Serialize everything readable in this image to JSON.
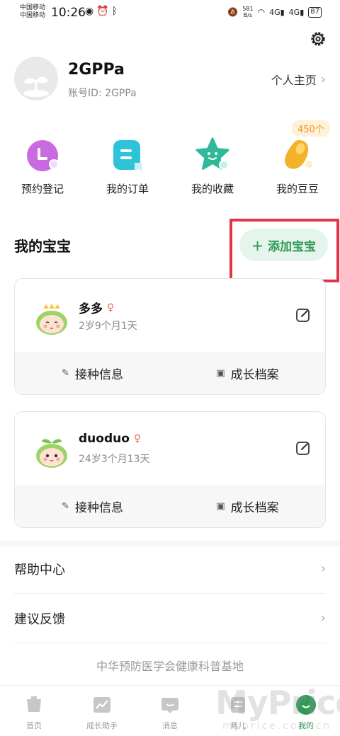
{
  "status_bar": {
    "carrier_1": "中国移动",
    "carrier_2": "中国移动",
    "time": "10:26",
    "net_speed_value": "581",
    "net_speed_unit": "B/s",
    "signal_1": "4G",
    "signal_2": "4G",
    "battery": "87"
  },
  "profile": {
    "username": "2GPPa",
    "account_id": "账号ID: 2GPPa",
    "homepage_label": "个人主页"
  },
  "quick_actions": [
    {
      "label": "预约登记",
      "icon": "appointment-icon",
      "color": "#c86be0"
    },
    {
      "label": "我的订单",
      "icon": "order-icon",
      "color": "#2fc3da"
    },
    {
      "label": "我的收藏",
      "icon": "favorite-star-icon",
      "color": "#2fb99a"
    },
    {
      "label": "我的豆豆",
      "icon": "bean-icon",
      "color": "#f2b32a"
    }
  ],
  "beans_count": "450个",
  "babies_section": {
    "title": "我的宝宝",
    "add_button": "添加宝宝"
  },
  "babies": [
    {
      "name": "多多",
      "age": "2岁9个月1天",
      "vaccine_label": "接种信息",
      "growth_label": "成长档案"
    },
    {
      "name": "duoduo",
      "age": "24岁3个月13天",
      "vaccine_label": "接种信息",
      "growth_label": "成长档案"
    }
  ],
  "menu": [
    {
      "label": "帮助中心"
    },
    {
      "label": "建议反馈"
    }
  ],
  "footer_note": "中华预防医学会健康科普基地",
  "tabs": [
    {
      "label": "首页",
      "icon": "home-icon"
    },
    {
      "label": "成长助手",
      "icon": "growth-chart-icon"
    },
    {
      "label": "消息",
      "icon": "message-icon"
    },
    {
      "label": "育儿",
      "icon": "parenting-icon"
    },
    {
      "label": "我的",
      "icon": "profile-icon",
      "active": true
    }
  ],
  "watermark": {
    "title": "MyPrice",
    "url": "myprice.com.cn"
  },
  "colors": {
    "accent_green": "#2f9a57",
    "highlight_red": "#e4344a"
  }
}
